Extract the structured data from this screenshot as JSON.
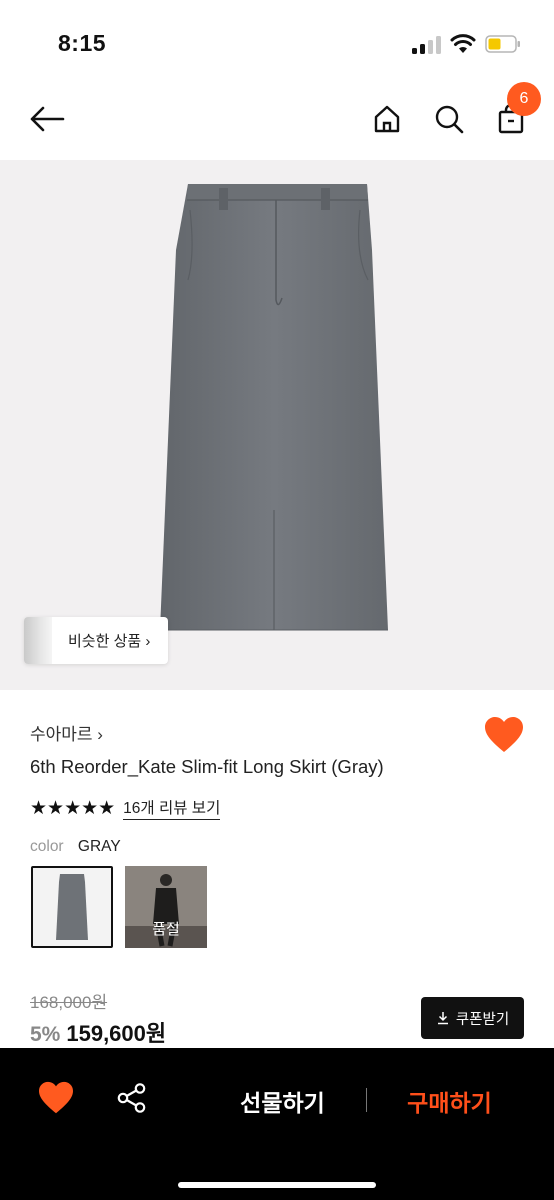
{
  "status_bar": {
    "time": "8:15"
  },
  "header": {
    "cart_count": "6"
  },
  "hero": {
    "similar_label": "비슷한 상품"
  },
  "product": {
    "brand": "수아마르",
    "title": "6th Reorder_Kate Slim-fit Long Skirt (Gray)",
    "rating_stars": "★★★★★",
    "rating_value": 5,
    "review_link": "16개 리뷰 보기",
    "color_label": "color",
    "color_value": "GRAY",
    "options": [
      {
        "status": ""
      },
      {
        "status": "품절"
      }
    ],
    "original_price": "168,000원",
    "discount": "5%",
    "price": "159,600원",
    "coupon_label": "쿠폰받기"
  },
  "bottom_bar": {
    "gift_label": "선물하기",
    "buy_label": "구매하기"
  },
  "colors": {
    "accent": "#ff5a1f",
    "buy_text": "#ff4f1a",
    "skirt": "#72767c",
    "bottom_bar_bg": "#000000"
  },
  "icons": [
    "back-arrow-icon",
    "home-icon",
    "search-icon",
    "cart-bag-icon",
    "chevron-right-icon",
    "heart-icon",
    "star-icon",
    "download-icon",
    "share-icon"
  ]
}
